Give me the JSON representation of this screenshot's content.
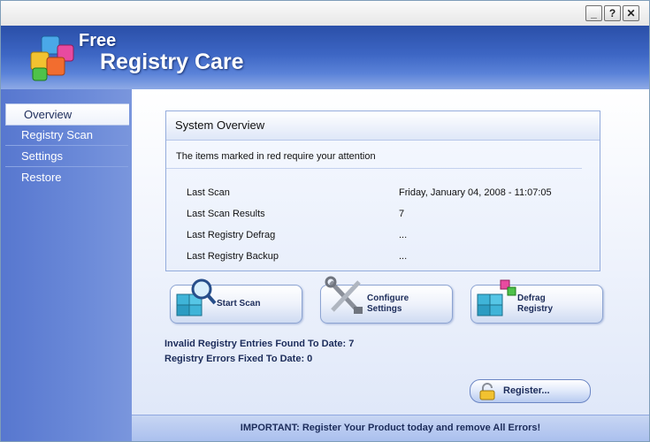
{
  "window": {
    "controls": {
      "minimize": "_",
      "help": "?",
      "close": "✕"
    }
  },
  "header": {
    "brand_line1": "Free",
    "brand_line2": "Registry Care",
    "logo_icon": "colored-cubes-logo"
  },
  "sidebar": {
    "items": [
      {
        "label": "Overview",
        "active": true
      },
      {
        "label": "Registry Scan",
        "active": false
      },
      {
        "label": "Settings",
        "active": false
      },
      {
        "label": "Restore",
        "active": false
      }
    ]
  },
  "overview": {
    "title": "System Overview",
    "notice": "The items marked in red require your attention",
    "rows": [
      {
        "label": "Last Scan",
        "value": "Friday, January 04, 2008 - 11:07:05"
      },
      {
        "label": "Last Scan Results",
        "value": "7"
      },
      {
        "label": "Last Registry Defrag",
        "value": "..."
      },
      {
        "label": "Last Registry Backup",
        "value": "..."
      }
    ]
  },
  "actions": {
    "start_scan": {
      "label": "Start Scan",
      "icon": "magnifier-cubes-icon"
    },
    "configure": {
      "label": "Configure\nSettings",
      "icon": "tools-icon"
    },
    "defrag": {
      "label": "Defrag\nRegistry",
      "icon": "defrag-cubes-icon"
    }
  },
  "stats": {
    "invalid_entries": "Invalid Registry Entries Found To Date: 7",
    "errors_fixed": "Registry Errors Fixed To Date: 0"
  },
  "register": {
    "label": "Register...",
    "icon": "padlock-icon"
  },
  "footer": {
    "text": "IMPORTANT: Register Your Product today and remove All Errors!"
  },
  "colors": {
    "header_dark": "#2a4fa8",
    "sidebar": "#5777cf",
    "text_dark": "#1c2c5a"
  }
}
